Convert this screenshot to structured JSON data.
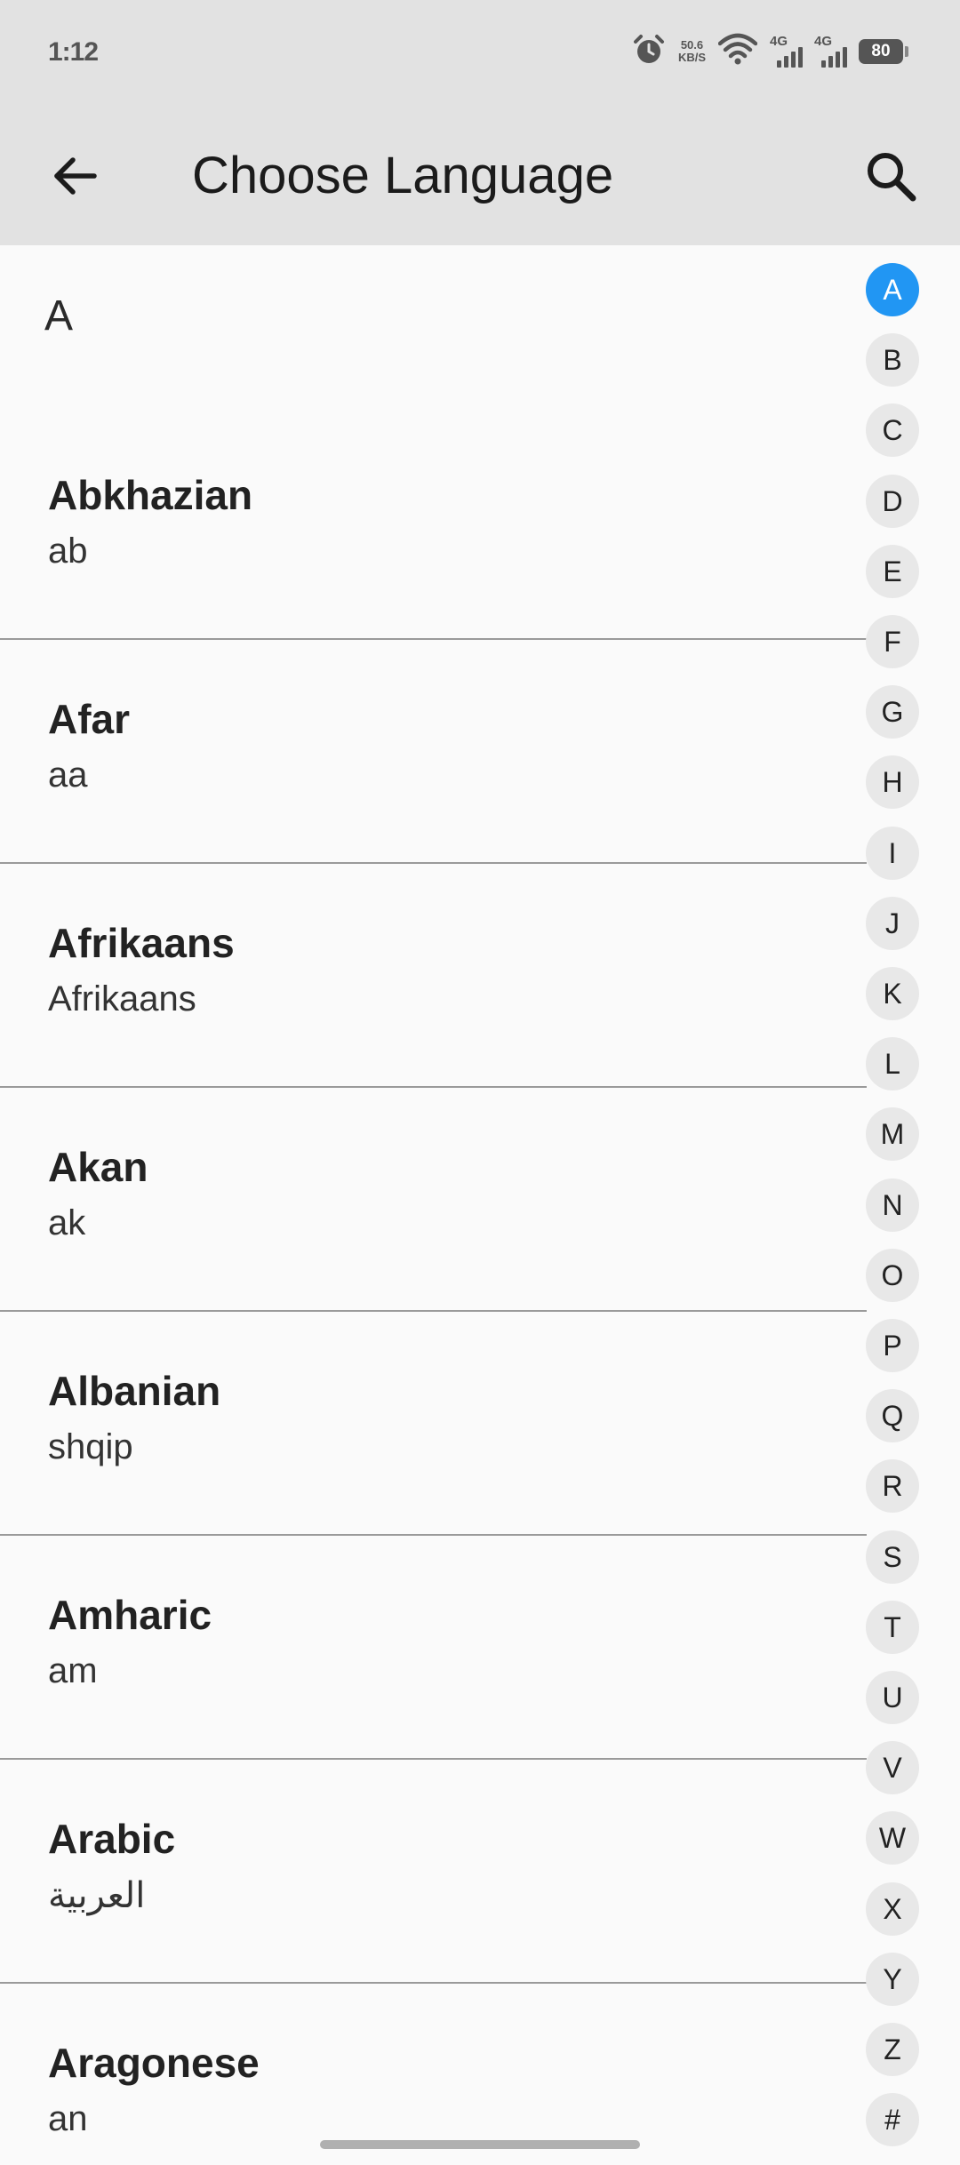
{
  "status_bar": {
    "time": "1:12",
    "net_speed_value": "50.6",
    "net_speed_unit": "KB/S",
    "sim1_label": "4G",
    "sim2_label": "4G",
    "battery_level": "80"
  },
  "app_bar": {
    "title": "Choose Language",
    "back_icon": "arrow-left-icon",
    "search_icon": "search-icon"
  },
  "section_header": "A",
  "languages": [
    {
      "name": "Abkhazian",
      "native": "ab"
    },
    {
      "name": "Afar",
      "native": "aa"
    },
    {
      "name": "Afrikaans",
      "native": "Afrikaans"
    },
    {
      "name": "Akan",
      "native": "ak"
    },
    {
      "name": "Albanian",
      "native": "shqip"
    },
    {
      "name": "Amharic",
      "native": "am"
    },
    {
      "name": "Arabic",
      "native": "العربية"
    },
    {
      "name": "Aragonese",
      "native": "an"
    }
  ],
  "alphabet_index": {
    "letters": [
      "A",
      "B",
      "C",
      "D",
      "E",
      "F",
      "G",
      "H",
      "I",
      "J",
      "K",
      "L",
      "M",
      "N",
      "O",
      "P",
      "Q",
      "R",
      "S",
      "T",
      "U",
      "V",
      "W",
      "X",
      "Y",
      "Z",
      "#"
    ],
    "active": "A",
    "active_color": "#2196f3"
  }
}
